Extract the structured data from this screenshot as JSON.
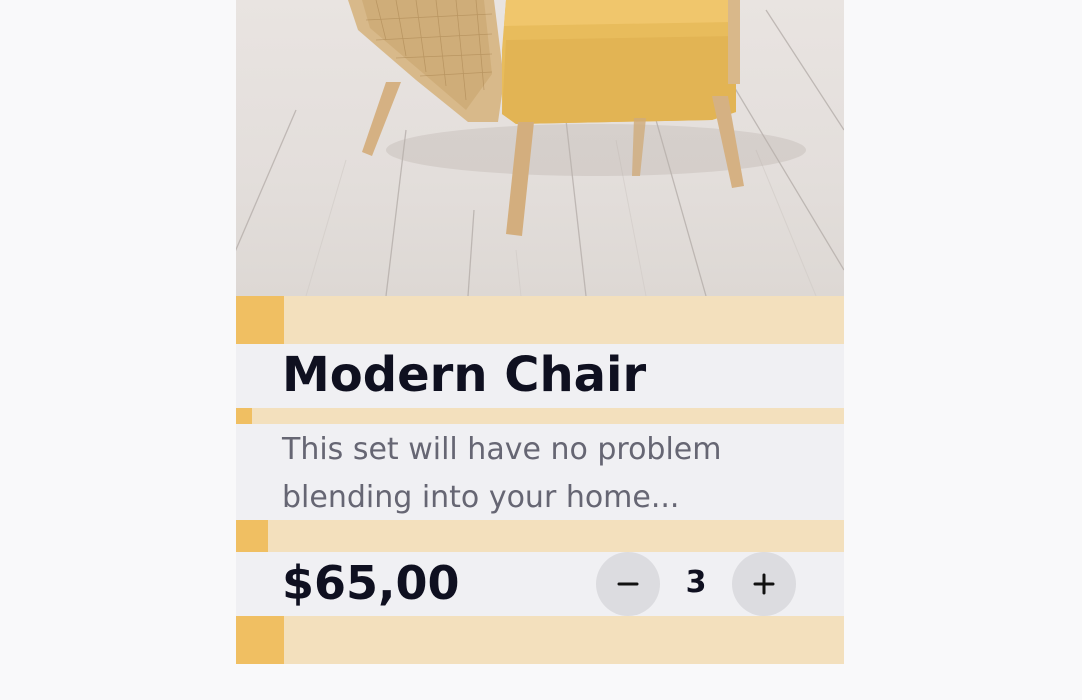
{
  "product": {
    "name": "Modern Chair",
    "description": "This set will have no problem blending into your home...",
    "price": "$65,00",
    "quantity": "3",
    "image_alt": "Modern Chair"
  },
  "controls": {
    "decrement_label": "Decrease quantity",
    "increment_label": "Increase quantity"
  },
  "colors": {
    "band": "#f3e0bd",
    "accent": "#f0bf62",
    "card_background": "#f0f0f3",
    "title": "#0f1020",
    "description": "#666673",
    "stepper_button": "#dcdce0"
  },
  "icons": {
    "decrement": "minus-icon",
    "increment": "plus-icon"
  }
}
